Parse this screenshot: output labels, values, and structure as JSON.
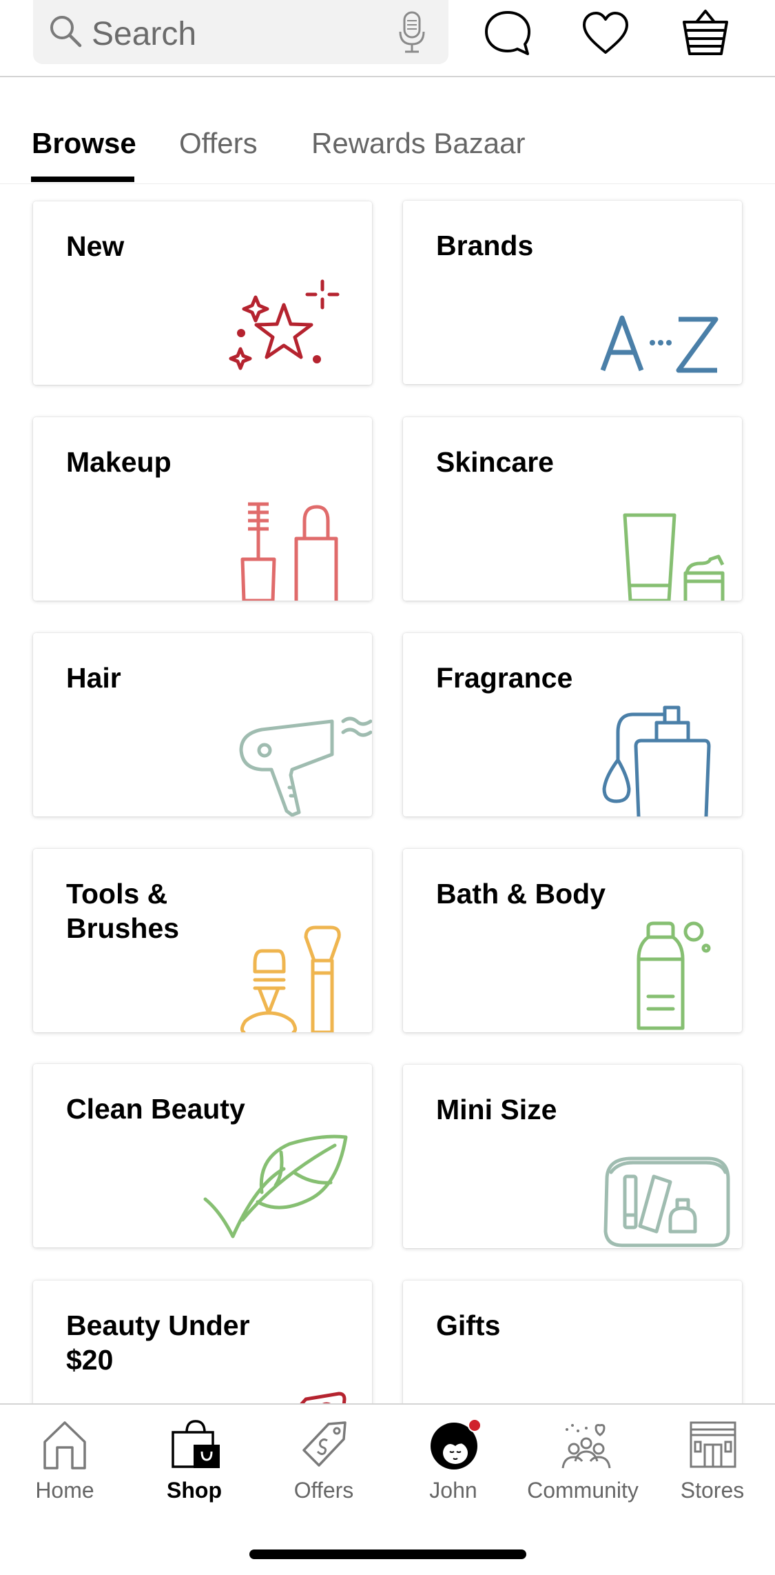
{
  "header": {
    "search_placeholder": "Search",
    "icons": [
      "search-icon",
      "microphone-icon",
      "chat-bubble-icon",
      "heart-icon",
      "basket-icon"
    ]
  },
  "tabs": [
    {
      "label": "Browse",
      "active": true
    },
    {
      "label": "Offers",
      "active": false
    },
    {
      "label": "Rewards Bazaar",
      "active": false
    }
  ],
  "categories": [
    {
      "label": "New",
      "icon": "sparkle-star-icon",
      "color": "#b5232f"
    },
    {
      "label": "Brands",
      "icon": "a-to-z-icon",
      "color": "#4a7fa8"
    },
    {
      "label": "Makeup",
      "icon": "mascara-lipstick-icon",
      "color": "#e06b6b"
    },
    {
      "label": "Skincare",
      "icon": "tube-jar-icon",
      "color": "#86bf72"
    },
    {
      "label": "Hair",
      "icon": "hair-dryer-icon",
      "color": "#9fbcb0"
    },
    {
      "label": "Fragrance",
      "icon": "perfume-bottle-icon",
      "color": "#4a7fa8"
    },
    {
      "label": "Tools & Brushes",
      "icon": "curler-brush-icon",
      "color": "#efb54f"
    },
    {
      "label": "Bath & Body",
      "icon": "lotion-bottle-icon",
      "color": "#86bf72"
    },
    {
      "label": "Clean Beauty",
      "icon": "leaf-check-icon",
      "color": "#86bf72"
    },
    {
      "label": "Mini Size",
      "icon": "travel-bag-icon",
      "color": "#9fbcb0"
    },
    {
      "label": "Beauty Under $20",
      "icon": "price-tag-icon",
      "color": "#b5232f"
    },
    {
      "label": "Gifts",
      "icon": "gift-box-icon",
      "color": "#e06b6b"
    }
  ],
  "bottom_nav": [
    {
      "label": "Home",
      "icon": "home-icon",
      "active": false
    },
    {
      "label": "Shop",
      "icon": "shopping-bag-icon",
      "active": true
    },
    {
      "label": "Offers",
      "icon": "tag-icon",
      "active": false
    },
    {
      "label": "John",
      "icon": "avatar-icon",
      "active": false,
      "notification_dot": true
    },
    {
      "label": "Community",
      "icon": "community-icon",
      "active": false
    },
    {
      "label": "Stores",
      "icon": "store-icon",
      "active": false
    }
  ],
  "colors": {
    "notification": "#d0212c",
    "inactive_text": "#666666",
    "active_text": "#000000"
  }
}
